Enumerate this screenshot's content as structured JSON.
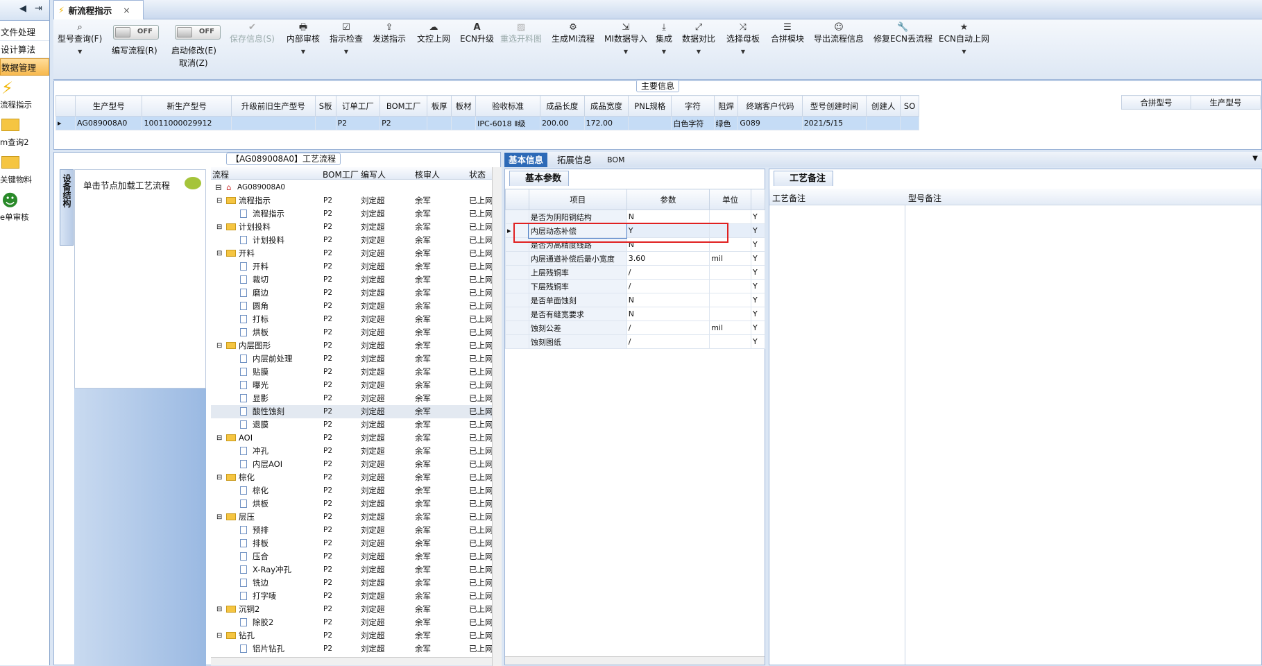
{
  "nav": {
    "items": [
      "文件处理",
      "设计算法",
      "数据管理"
    ],
    "icons": [
      {
        "label": "流程指示",
        "icon": "lightning-icon"
      },
      {
        "label": "m查询2",
        "icon": "folder-icon"
      },
      {
        "label": "关键物料",
        "icon": "folder-icon"
      },
      {
        "label": "e单审核",
        "icon": "user-icon"
      }
    ]
  },
  "tab": {
    "title": "新流程指示",
    "close": "×"
  },
  "toolbar": {
    "model_query": "型号查询(F)",
    "edit_flow": "编写流程(R)",
    "start_modify": "启动修改(E)",
    "cancel": "取消(Z)",
    "toggle_off": "OFF",
    "save_info": "保存信息(S)",
    "internal_review": "内部审核",
    "instr_check": "指示检查",
    "send_instr": "发送指示",
    "upload": "文控上网",
    "ecn_upgrade": "ECN升级",
    "reselect_map": "重选开料图",
    "gen_mi": "生成MI流程",
    "mi_import": "MI数据导入",
    "integrate": "集成",
    "compare": "数据对比",
    "select_mother": "选择母板",
    "merge_module": "合拼模块",
    "export_flow": "导出流程信息",
    "fix_ecn": "修复ECN丢流程",
    "ecn_auto": "ECN自动上网"
  },
  "main_info": {
    "title": "主要信息",
    "headers": [
      "生产型号",
      "新生产型号",
      "升级前旧生产型号",
      "S板",
      "订单工厂",
      "BOM工厂",
      "板厚",
      "板材",
      "验收标准",
      "成品长度",
      "成品宽度",
      "PNL规格",
      "字符",
      "阻焊",
      "终端客户代码",
      "型号创建时间",
      "创建人",
      "SO"
    ],
    "row": [
      "AG089008A0",
      "10011000029912",
      "",
      "",
      "P2",
      "P2",
      "",
      "",
      "IPC-6018 Ⅱ级",
      "200.00",
      "172.00",
      "",
      "白色字符",
      "绿色",
      "G089",
      "2021/5/15",
      "",
      ""
    ],
    "right_headers": [
      "合拼型号",
      "生产型号"
    ]
  },
  "flow": {
    "title": "【AG089008A0】工艺流程",
    "side_tab": "设备结构",
    "hint": "单击节点加载工艺流程",
    "headers": [
      "流程",
      "BOM工厂",
      "编写人",
      "核审人",
      "状态"
    ],
    "root": "AG089008A0",
    "rows": [
      {
        "name": "流程指示",
        "level": 1
      },
      {
        "name": "流程指示",
        "level": 2
      },
      {
        "name": "计划投料",
        "level": 1
      },
      {
        "name": "计划投料",
        "level": 2
      },
      {
        "name": "开料",
        "level": 1
      },
      {
        "name": "开料",
        "level": 2
      },
      {
        "name": "裁切",
        "level": 2
      },
      {
        "name": "磨边",
        "level": 2
      },
      {
        "name": "圆角",
        "level": 2
      },
      {
        "name": "打标",
        "level": 2
      },
      {
        "name": "烘板",
        "level": 2
      },
      {
        "name": "内层图形",
        "level": 1
      },
      {
        "name": "内层前处理",
        "level": 2
      },
      {
        "name": "贴膜",
        "level": 2
      },
      {
        "name": "曝光",
        "level": 2
      },
      {
        "name": "显影",
        "level": 2
      },
      {
        "name": "酸性蚀刻",
        "level": 2,
        "sel": true
      },
      {
        "name": "退膜",
        "level": 2
      },
      {
        "name": "AOI",
        "level": 1
      },
      {
        "name": "冲孔",
        "level": 2
      },
      {
        "name": "内层AOI",
        "level": 2
      },
      {
        "name": "棕化",
        "level": 1
      },
      {
        "name": "棕化",
        "level": 2
      },
      {
        "name": "烘板",
        "level": 2
      },
      {
        "name": "层压",
        "level": 1
      },
      {
        "name": "预排",
        "level": 2
      },
      {
        "name": "排板",
        "level": 2
      },
      {
        "name": "压合",
        "level": 2
      },
      {
        "name": "X-Ray冲孔",
        "level": 2
      },
      {
        "name": "铣边",
        "level": 2
      },
      {
        "name": "打字唛",
        "level": 2
      },
      {
        "name": "沉铜2",
        "level": 1
      },
      {
        "name": "除胶2",
        "level": 2
      },
      {
        "name": "钻孔",
        "level": 1
      },
      {
        "name": "铝片钻孔",
        "level": 2
      }
    ],
    "bom": "P2",
    "writer": "刘定超",
    "reviewer": "余军",
    "status": "已上网"
  },
  "right_tabs": [
    "基本信息",
    "拓展信息",
    "BOM"
  ],
  "basic": {
    "tab": "基本参数",
    "headers": [
      "项目",
      "参数",
      "单位"
    ],
    "rows": [
      [
        "是否为阴阳铜结构",
        "N",
        "",
        "Y"
      ],
      [
        "内层动态补偿",
        "Y",
        "",
        "Y"
      ],
      [
        "是否为高精度线路",
        "N",
        "",
        "Y"
      ],
      [
        "内层通道补偿后最小宽度",
        "3.60",
        "mil",
        "Y"
      ],
      [
        "上层残铜率",
        "/",
        "",
        "Y"
      ],
      [
        "下层残铜率",
        "/",
        "",
        "Y"
      ],
      [
        "是否单面蚀刻",
        "N",
        "",
        "Y"
      ],
      [
        "是否有缝宽要求",
        "N",
        "",
        "Y"
      ],
      [
        "蚀刻公差",
        "/",
        "mil",
        "Y"
      ],
      [
        "蚀刻图纸",
        "/",
        "",
        "Y"
      ]
    ]
  },
  "notes": {
    "tab": "工艺备注",
    "col1": "工艺备注",
    "col2": "型号备注"
  }
}
